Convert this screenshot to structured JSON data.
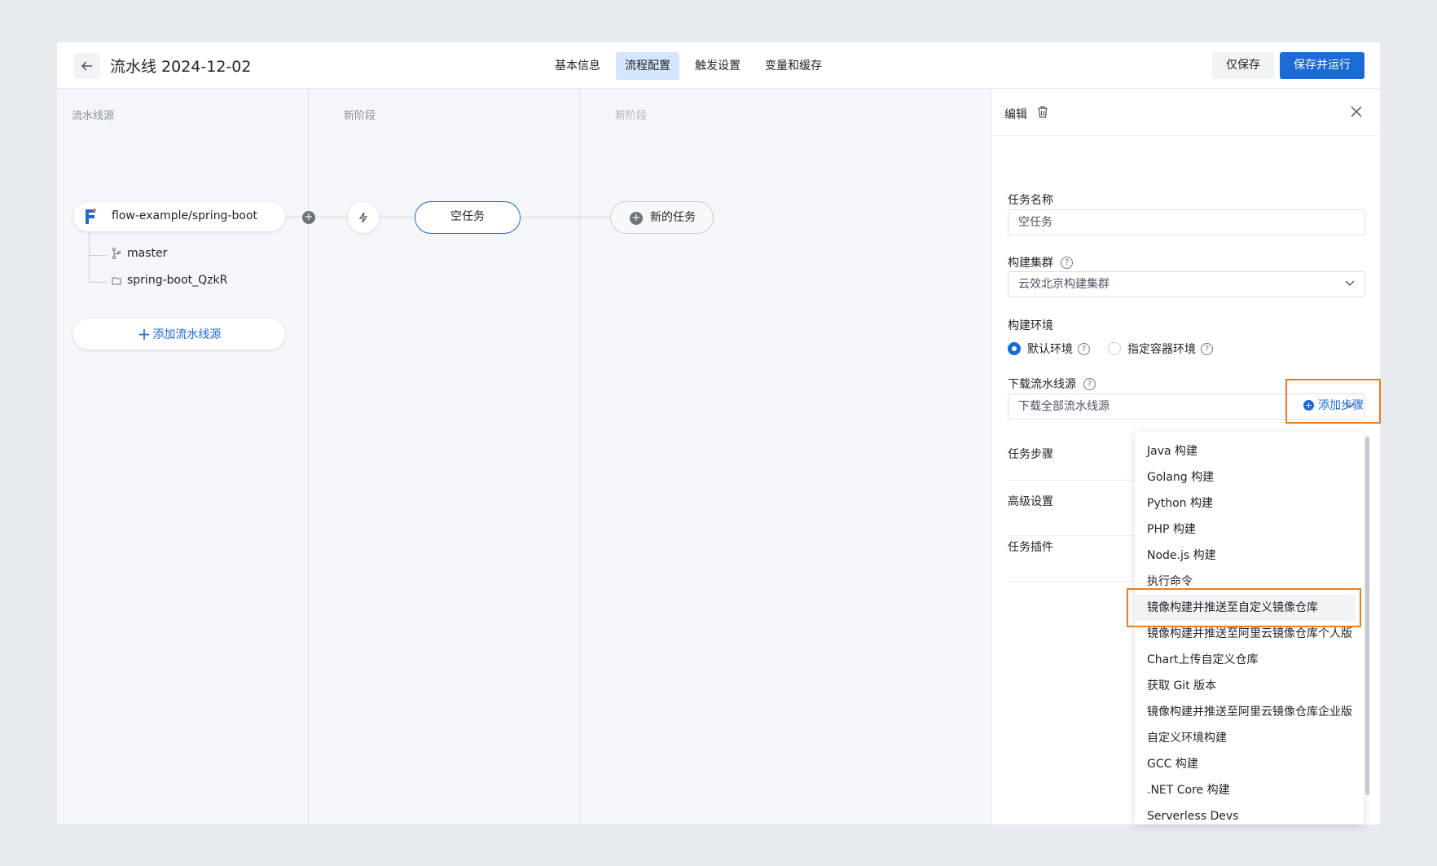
{
  "header": {
    "title": "流水线 2024-12-02",
    "tabs": [
      "基本信息",
      "流程配置",
      "触发设置",
      "变量和缓存"
    ],
    "active_tab": 1,
    "save_label": "仅保存",
    "save_run_label": "保存并运行"
  },
  "canvas": {
    "columns": [
      "流水线源",
      "新阶段",
      "新阶段"
    ],
    "source": {
      "name": "flow-example/spring-boot",
      "branch": "master",
      "workspace": "spring-boot_QzkR"
    },
    "add_source_label": "添加流水线源",
    "task_label": "空任务",
    "new_task_label": "新的任务"
  },
  "panel": {
    "title": "编辑",
    "task_name_label": "任务名称",
    "task_name_value": "空任务",
    "cluster_label": "构建集群",
    "cluster_value": "云效北京构建集群",
    "env_label": "构建环境",
    "env_options": [
      "默认环境",
      "指定容器环境"
    ],
    "env_selected": 0,
    "download_label": "下载流水线源",
    "download_value": "下载全部流水线源",
    "steps_label": "任务步骤",
    "add_step_label": "添加步骤",
    "advanced_label": "高级设置",
    "plugins_label": "任务插件"
  },
  "dropdown": {
    "items": [
      "Java 构建",
      "Golang 构建",
      "Python 构建",
      "PHP 构建",
      "Node.js 构建",
      "执行命令",
      "镜像构建并推送至自定义镜像仓库",
      "镜像构建并推送至阿里云镜像仓库个人版",
      "Chart上传自定义仓库",
      "获取 Git 版本",
      "镜像构建并推送至阿里云镜像仓库企业版",
      "自定义环境构建",
      "GCC 构建",
      ".NET Core 构建",
      "Serverless Devs"
    ],
    "hovered_index": 6
  },
  "colors": {
    "accent": "#1b6ad6",
    "highlight": "#f07d1c"
  }
}
